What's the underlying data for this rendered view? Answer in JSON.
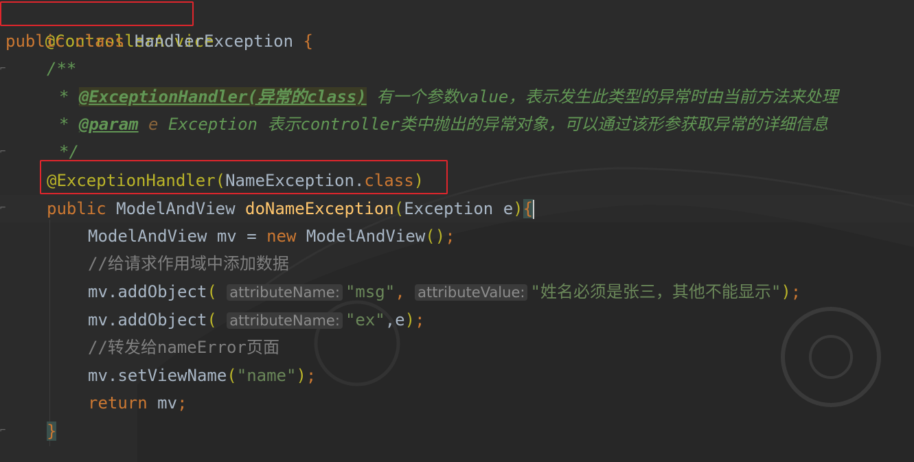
{
  "colors": {
    "background": "#2b2b2b",
    "annotation": "#bbb529",
    "keyword": "#cc7832",
    "string": "#6a8759",
    "method": "#ffc66d",
    "comment": "#808080",
    "doc_comment": "#629755",
    "highlight_box": "#e0262c"
  },
  "editor": {
    "line1": {
      "annotation": "@ControllerAdvice"
    },
    "line2": {
      "kw_public": "public",
      "kw_class": "class",
      "class_name": "HandlerException",
      "brace": "{"
    },
    "line3": {
      "doc_open": "/**"
    },
    "line4": {
      "star": "*",
      "tag": "@ExceptionHandler(异常的class)",
      "text": " 有一个参数value，表示发生此类型的异常时由当前方法来处理"
    },
    "line5": {
      "star": "*",
      "tag": "@param",
      "param": " e",
      "text": " Exception 表示controller类中抛出的异常对象，可以通过该形参获取异常的详细信息"
    },
    "line6": {
      "doc_close": "*/"
    },
    "line7": {
      "annotation": "@ExceptionHandler",
      "open": "(",
      "type": "NameException",
      "dot": ".",
      "kw_class": "class",
      "close": ")"
    },
    "line8": {
      "kw_public": "public",
      "return_type": " ModelAndView ",
      "method": "doNameException",
      "open": "(",
      "params": "Exception e",
      "close": ")",
      "brace": "{"
    },
    "line9": {
      "text": "ModelAndView mv = ",
      "kw_new": "new",
      "ctor": " ModelAndView",
      "parens": "()",
      "semi": ";"
    },
    "line10": {
      "comment": "//给请求作用域中添加数据"
    },
    "line11": {
      "call": "mv.addObject",
      "open": "(",
      "hint1": "attributeName:",
      "arg1": "\"msg\"",
      "comma": ",",
      "hint2": "attributeValue:",
      "arg2": "\"姓名必须是张三，其他不能显示\"",
      "close": ")",
      "semi": ";"
    },
    "line12": {
      "call": "mv.addObject",
      "open": "(",
      "hint1": "attributeName:",
      "arg1": "\"ex\"",
      "rest": ",e",
      "close": ")",
      "semi": ";"
    },
    "line13": {
      "comment": "//转发给nameError页面"
    },
    "line14": {
      "call": "mv.setViewName",
      "open": "(",
      "arg": "\"name\"",
      "close": ")",
      "semi": ";"
    },
    "line15": {
      "kw_return": "return",
      "rest": " mv",
      "semi": ";"
    },
    "line16": {
      "brace": "}"
    }
  }
}
